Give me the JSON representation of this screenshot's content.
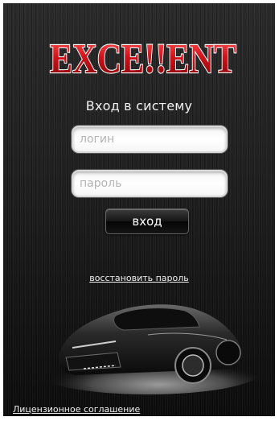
{
  "app": {
    "logo_text": "EXCE!!ENT"
  },
  "login": {
    "title": "Вход в систему",
    "login_placeholder": "логин",
    "password_placeholder": "пароль",
    "login_value": "",
    "password_value": "",
    "submit_label": "вход",
    "restore_label": "восстановить пароль"
  },
  "footer": {
    "license_label": "Лицензионное соглашение"
  },
  "colors": {
    "logo_red": "#c8141a",
    "background": "#1a1a1a",
    "text": "#f0f0f0"
  }
}
